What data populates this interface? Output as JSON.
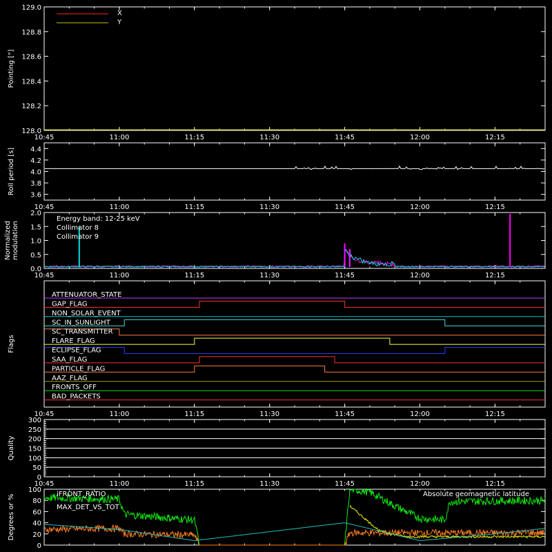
{
  "colors": {
    "background": "#000000",
    "axes": "#ffffff",
    "x": "#ff2020",
    "y": "#c8c800",
    "roll": "#ffffff",
    "cyan": "#00e0e0",
    "magenta": "#ff00ff",
    "green": "#10f010",
    "orange": "#ff8020",
    "yellow": "#f0f000",
    "lat": "#20c0c0"
  },
  "chart_data": [
    {
      "type": "line",
      "name_id": "pointing",
      "ylabel": "Pointing [\"]",
      "ylim": [
        128.0,
        129.0
      ],
      "yticks": [
        "128.0",
        "128.2",
        "128.4",
        "128.6",
        "128.8",
        "129.0"
      ],
      "xticks": [
        "10:45",
        "11:00",
        "11:15",
        "11:30",
        "11:45",
        "12:00",
        "12:15"
      ],
      "legend": [
        "X",
        "Y"
      ],
      "series": [
        {
          "name": "X",
          "color": "#ff2020",
          "x": [
            "10:45",
            "12:25"
          ],
          "y": [
            128.0,
            128.0
          ]
        },
        {
          "name": "Y",
          "color": "#c8c800",
          "x": [
            "10:45",
            "12:25"
          ],
          "y": [
            128.0,
            128.0
          ]
        }
      ]
    },
    {
      "type": "line",
      "name_id": "roll",
      "ylabel": "Roll period [s]",
      "ylim": [
        3.5,
        4.5
      ],
      "yticks": [
        "3.6",
        "3.8",
        "4.0",
        "4.2",
        "4.4"
      ],
      "xticks": [
        "10:45",
        "11:00",
        "11:15",
        "11:30",
        "11:45",
        "12:00",
        "12:15"
      ],
      "series": [
        {
          "name": "roll",
          "x": [
            "10:45",
            "12:25"
          ],
          "y": [
            4.05,
            4.05
          ]
        }
      ]
    },
    {
      "type": "line",
      "name_id": "modulation",
      "ylabel": [
        "Normalized",
        "modulation"
      ],
      "ylim": [
        0.0,
        2.0
      ],
      "yticks": [
        "0.0",
        "0.5",
        "1.0",
        "1.5",
        "2.0"
      ],
      "xticks": [
        "10:45",
        "11:00",
        "11:15",
        "11:30",
        "11:45",
        "12:00",
        "12:15"
      ],
      "annotations": [
        "Energy band: 12-25 keV",
        "Collimator 8",
        "Collimator 9"
      ],
      "series": [
        {
          "name": "Collimator 8",
          "color": "#00e0e0",
          "spikes": [
            [
              "10:52",
              1.5
            ],
            [
              "11:45",
              0.8
            ],
            [
              "11:46",
              0.6
            ]
          ]
        },
        {
          "name": "Collimator 9",
          "color": "#ff00ff",
          "spikes": [
            [
              "11:45",
              0.9
            ],
            [
              "11:46",
              0.7
            ],
            [
              "12:18",
              1.95
            ]
          ]
        }
      ]
    },
    {
      "type": "line",
      "name_id": "flags",
      "ylabel": "Flags",
      "xticks": [
        "10:45",
        "11:00",
        "11:15",
        "11:30",
        "11:45",
        "12:00",
        "12:15"
      ],
      "flags": [
        {
          "label": "ATTENUATOR_STATE",
          "color": "#c040ff",
          "high": []
        },
        {
          "label": "GAP_FLAG",
          "color": "#ff3030",
          "high": [
            [
              "11:16",
              "11:45"
            ]
          ]
        },
        {
          "label": "NON_SOLAR_EVENT",
          "color": "#00c8c8",
          "high": []
        },
        {
          "label": "SC_IN_SUNLIGHT",
          "color": "#40e0e0",
          "high": [
            [
              "11:01",
              "12:05"
            ]
          ]
        },
        {
          "label": "SC_TRANSMITTER",
          "color": "#ff8040",
          "high": [
            [
              "10:45",
              "11:00"
            ]
          ]
        },
        {
          "label": "FLARE_FLAG",
          "color": "#ffff40",
          "high": [
            [
              "11:15",
              "11:54"
            ]
          ]
        },
        {
          "label": "ECLIPSE_FLAG",
          "color": "#2040ff",
          "high": [
            [
              "10:45",
              "11:01"
            ],
            [
              "12:05",
              "12:25"
            ]
          ]
        },
        {
          "label": "SAA_FLAG",
          "color": "#ff3030",
          "high": [
            [
              "11:16",
              "11:43"
            ]
          ]
        },
        {
          "label": "PARTICLE_FLAG",
          "color": "#ff8040",
          "high": [
            [
              "11:15",
              "11:41"
            ]
          ]
        },
        {
          "label": "AAZ_FLAG",
          "color": "#a0a000",
          "high": []
        },
        {
          "label": "FRONTS_OFF",
          "color": "#10e010",
          "high": []
        },
        {
          "label": "BAD_PACKETS",
          "color": "#ff3030",
          "high": []
        }
      ]
    },
    {
      "type": "line",
      "name_id": "quality",
      "ylabel": "Quality",
      "ylim": [
        0,
        300
      ],
      "yticks": [
        "0",
        "50",
        "100",
        "150",
        "200",
        "250",
        "300"
      ],
      "xticks": [
        "10:45",
        "11:00",
        "11:15",
        "11:30",
        "11:45",
        "12:00",
        "12:15"
      ]
    },
    {
      "type": "line",
      "name_id": "ratio",
      "ylabel": "Degrees or %",
      "ylim": [
        0,
        100
      ],
      "yticks": [
        "0",
        "20",
        "40",
        "60",
        "80",
        "100"
      ],
      "legend": [
        "iFRONT_RATIO",
        "MAX_DET_VS_TOT",
        "Absolute geomagnetic latitude"
      ],
      "series": [
        {
          "name": "iFRONT_RATIO",
          "color": "#10f010",
          "x": [
            "10:45",
            "11:00",
            "11:01",
            "11:15",
            "11:16",
            "11:45",
            "11:46",
            "11:50",
            "11:55",
            "12:00",
            "12:05",
            "12:06",
            "12:25"
          ],
          "y": [
            85,
            82,
            55,
            45,
            0,
            0,
            100,
            95,
            70,
            48,
            45,
            78,
            80
          ]
        },
        {
          "name": "MAX_DET_VS_TOT",
          "color": "#ff8020",
          "x": [
            "10:45",
            "11:00",
            "11:01",
            "11:15",
            "11:16",
            "11:45",
            "11:46",
            "12:25"
          ],
          "y": [
            28,
            30,
            20,
            18,
            0,
            0,
            22,
            22
          ]
        },
        {
          "name": "yellow",
          "color": "#f0f000",
          "x": [
            "11:46",
            "11:48",
            "11:52",
            "11:57",
            "12:25"
          ],
          "y": [
            70,
            55,
            25,
            15,
            15
          ]
        },
        {
          "name": "Absolute geomagnetic latitude",
          "color": "#20c0c0",
          "x": [
            "10:45",
            "11:00",
            "11:15",
            "11:30",
            "11:45",
            "12:00",
            "12:15",
            "12:25"
          ],
          "y": [
            37,
            28,
            8,
            24,
            40,
            8,
            20,
            30
          ]
        }
      ]
    }
  ]
}
